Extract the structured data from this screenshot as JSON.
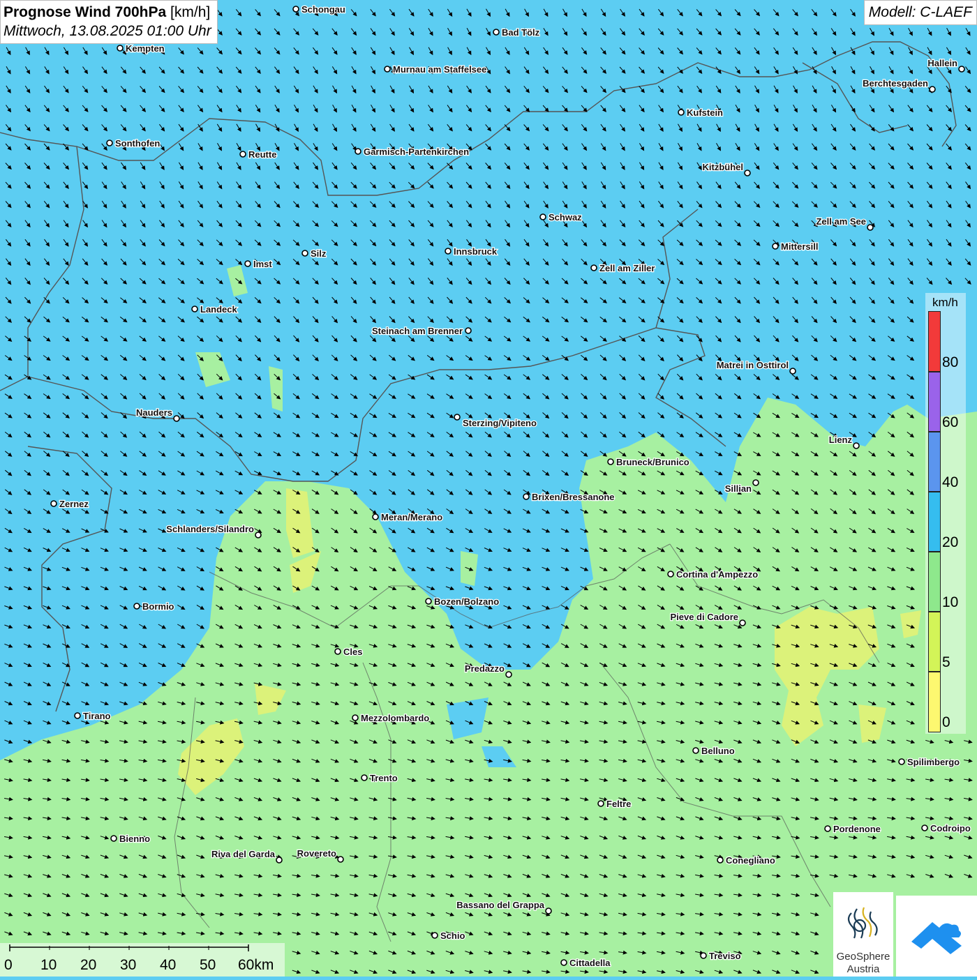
{
  "header": {
    "title_bold": "Prognose Wind 700hPa",
    "title_unit": "[km/h]",
    "datetime": "Mittwoch, 13.08.2025 01:00 Uhr"
  },
  "model": {
    "label": "Modell: C-LAEF"
  },
  "legend": {
    "unit": "km/h",
    "classes": [
      {
        "label": "80",
        "color": "#f23a3a"
      },
      {
        "label": "60",
        "color": "#9a63ea"
      },
      {
        "label": "40",
        "color": "#5b95ee"
      },
      {
        "label": "20",
        "color": "#35bdef"
      },
      {
        "label": "10",
        "color": "#8ee88c"
      },
      {
        "label": "5",
        "color": "#d3f458"
      },
      {
        "label": "0",
        "color": "#fdf870"
      }
    ]
  },
  "scale_bar": {
    "labels": [
      "0",
      "10",
      "20",
      "30",
      "40",
      "50",
      "60km"
    ]
  },
  "logo": {
    "line1": "GeoSphere",
    "line2": "Austria"
  },
  "wind": {
    "prevailing_direction": "from north-northwest"
  },
  "map_colors": {
    "strong_wind": "#5ccdf2",
    "moderate_wind": "#a7f0a1",
    "weak_wind": "#dcf27a",
    "border": "#555555"
  },
  "cities": [
    "Schongau",
    "Kempten",
    "Bad Tölz",
    "Hallein",
    "Murnau am Staffelsee",
    "Berchtesgaden",
    "Kufstein",
    "Sonthofen",
    "Reutte",
    "Garmisch-Partenkirchen",
    "Kitzbühel",
    "Schwaz",
    "Zell am See",
    "Innsbruck",
    "Mittersill",
    "Silz",
    "Imst",
    "Zell am Ziller",
    "Landeck",
    "Steinach am Brenner",
    "Matrei in Osttirol",
    "Nauders",
    "Sterzing/Vipiteno",
    "Lienz",
    "Bruneck/Brunico",
    "Sillian",
    "Brixen/Bressanone",
    "Zernez",
    "Meran/Merano",
    "Schlanders/Silandro",
    "Cortina d'Ampezzo",
    "Bozen/Bolzano",
    "Bormio",
    "Pieve di Cadore",
    "Cles",
    "Predazzo",
    "Tirano",
    "Mezzolombardo",
    "Belluno",
    "Spilimbergo",
    "Trento",
    "Feltre",
    "Pordenone",
    "Codroipo",
    "Bienno",
    "Riva del Garda",
    "Rovereto",
    "Conegliano",
    "Bassano del Grappa",
    "Schio",
    "Treviso",
    "Cittadella"
  ]
}
